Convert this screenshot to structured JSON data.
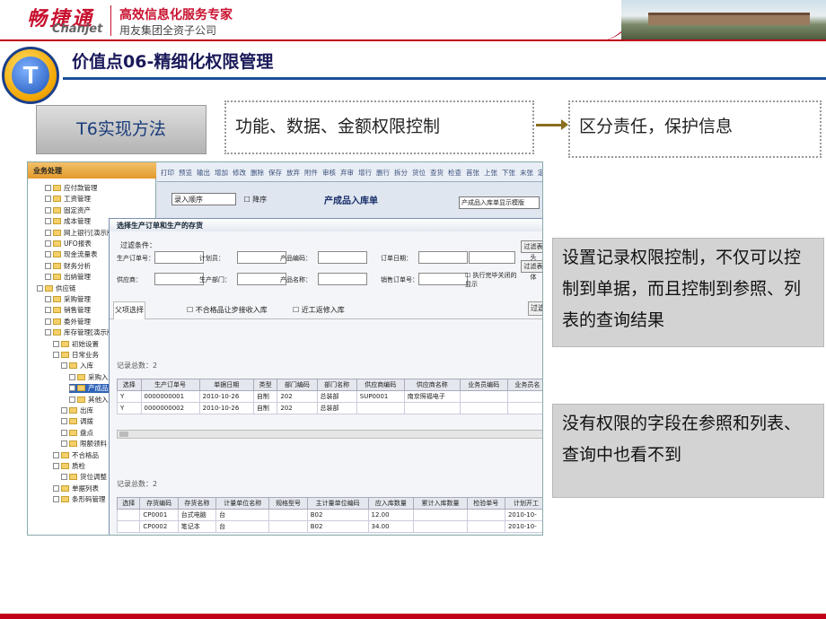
{
  "header": {
    "logo_cn": "畅捷通",
    "logo_en": "Chanjet",
    "slogan": "高效信息化服务专家",
    "subslogan": "用友集团全资子公司"
  },
  "page": {
    "badge_letter": "T",
    "title": "价值点06-精细化权限管理",
    "method_label": "T6实现方法",
    "method_desc": "功能、数据、金额权限控制",
    "result_desc": "区分责任，保护信息",
    "note1": "设置记录权限控制，不仅可以控制到单据，而且控制到参照、列表的查询结果",
    "note2": "没有权限的字段在参照和列表、查询中也看不到"
  },
  "app": {
    "sidebar_title": "业务处理",
    "tree": [
      {
        "label": "应付款管理",
        "indent": 0,
        "exp": false
      },
      {
        "label": "工资管理",
        "indent": 0,
        "exp": false
      },
      {
        "label": "固定资产",
        "indent": 0,
        "exp": false
      },
      {
        "label": "成本管理",
        "indent": 0,
        "exp": false
      },
      {
        "label": "网上银行[演示版]",
        "indent": 0,
        "exp": true
      },
      {
        "label": "UFO报表",
        "indent": 0,
        "exp": false
      },
      {
        "label": "现金流量表",
        "indent": 0,
        "exp": false
      },
      {
        "label": "财务分析",
        "indent": 0,
        "exp": false
      },
      {
        "label": "出纳管理",
        "indent": 0,
        "exp": false
      },
      {
        "label": "供应链",
        "indent": -1,
        "exp": true
      },
      {
        "label": "采购管理",
        "indent": 0,
        "exp": false
      },
      {
        "label": "销售管理",
        "indent": 0,
        "exp": false
      },
      {
        "label": "委外管理",
        "indent": 0,
        "exp": false
      },
      {
        "label": "库存管理[演示版]",
        "indent": 0,
        "exp": true
      },
      {
        "label": "初始设置",
        "indent": 1,
        "exp": true
      },
      {
        "label": "日常业务",
        "indent": 1,
        "exp": true
      },
      {
        "label": "入库",
        "indent": 2,
        "exp": true
      },
      {
        "label": "采购入库单",
        "indent": 3,
        "exp": false
      },
      {
        "label": "产成品入库",
        "indent": 3,
        "exp": false,
        "hl": true
      },
      {
        "label": "其他入库单",
        "indent": 3,
        "exp": false
      },
      {
        "label": "出库",
        "indent": 2,
        "exp": true
      },
      {
        "label": "调拨",
        "indent": 2,
        "exp": false
      },
      {
        "label": "盘点",
        "indent": 2,
        "exp": false
      },
      {
        "label": "限额领料",
        "indent": 2,
        "exp": false
      },
      {
        "label": "不合格品",
        "indent": 1,
        "exp": true
      },
      {
        "label": "质检",
        "indent": 1,
        "exp": true
      },
      {
        "label": "货位调整",
        "indent": 2,
        "exp": false
      },
      {
        "label": "单据列表",
        "indent": 1,
        "exp": true
      },
      {
        "label": "条形码管理",
        "indent": 1,
        "exp": true
      }
    ],
    "toolbar": [
      "打印",
      "预览",
      "输出",
      "增加",
      "修改",
      "删除",
      "保存",
      "放弃",
      "附件",
      "审核",
      "弃审",
      "增行",
      "删行",
      "拆分",
      "货位",
      "查货",
      "检查",
      "首张",
      "上张",
      "下张",
      "末张",
      "定位"
    ],
    "order_select": "录入顺序",
    "desc_checkbox": "降序",
    "form_title": "产成品入库单",
    "template_select": "产成品入库单显示模版",
    "dialog": {
      "title": "选择生产订单和生产的存货",
      "filter_label": "过滤条件：",
      "fields_row1": [
        "生产订单号：",
        "计划员：",
        "产品编码：",
        "订单日期："
      ],
      "fields_row2": [
        "供应商：",
        "生产部门：",
        "产品名称：",
        "销售订单号："
      ],
      "close_check": "执行完毕关闭的显示",
      "btn_filter": "过滤表头",
      "btn_filter2": "过滤表体",
      "tab": "父项选择",
      "check1": "不合格品让步接收入库",
      "check2": "近工返修入库",
      "btn_pass": "过滤",
      "count1": "记录总数：2",
      "count2": "记录总数：2",
      "grid1": {
        "cols": [
          "选择",
          "生产订单号",
          "单据日期",
          "类型",
          "部门编码",
          "部门名称",
          "供应商编码",
          "供应商名称",
          "业务员编码",
          "业务员名"
        ],
        "rows": [
          [
            "Y",
            "0000000001",
            "2010-10-26",
            "自制",
            "202",
            "总装部",
            "SUP0001",
            "南京照福电子",
            "",
            ""
          ],
          [
            "Y",
            "0000000002",
            "2010-10-26",
            "自制",
            "202",
            "总装部",
            "",
            "",
            "",
            ""
          ]
        ]
      },
      "grid2": {
        "cols": [
          "选择",
          "存货编码",
          "存货名称",
          "计量单位名称",
          "规格型号",
          "主计量单位编码",
          "应入库数量",
          "累计入库数量",
          "检验单号",
          "计划开工"
        ],
        "rows": [
          [
            "",
            "CP0001",
            "台式电脑",
            "台",
            "",
            "B02",
            "12.00",
            "",
            "",
            "2010-10-"
          ],
          [
            "",
            "CP0002",
            "笔记本",
            "台",
            "",
            "B02",
            "34.00",
            "",
            "",
            "2010-10-"
          ]
        ]
      }
    }
  }
}
